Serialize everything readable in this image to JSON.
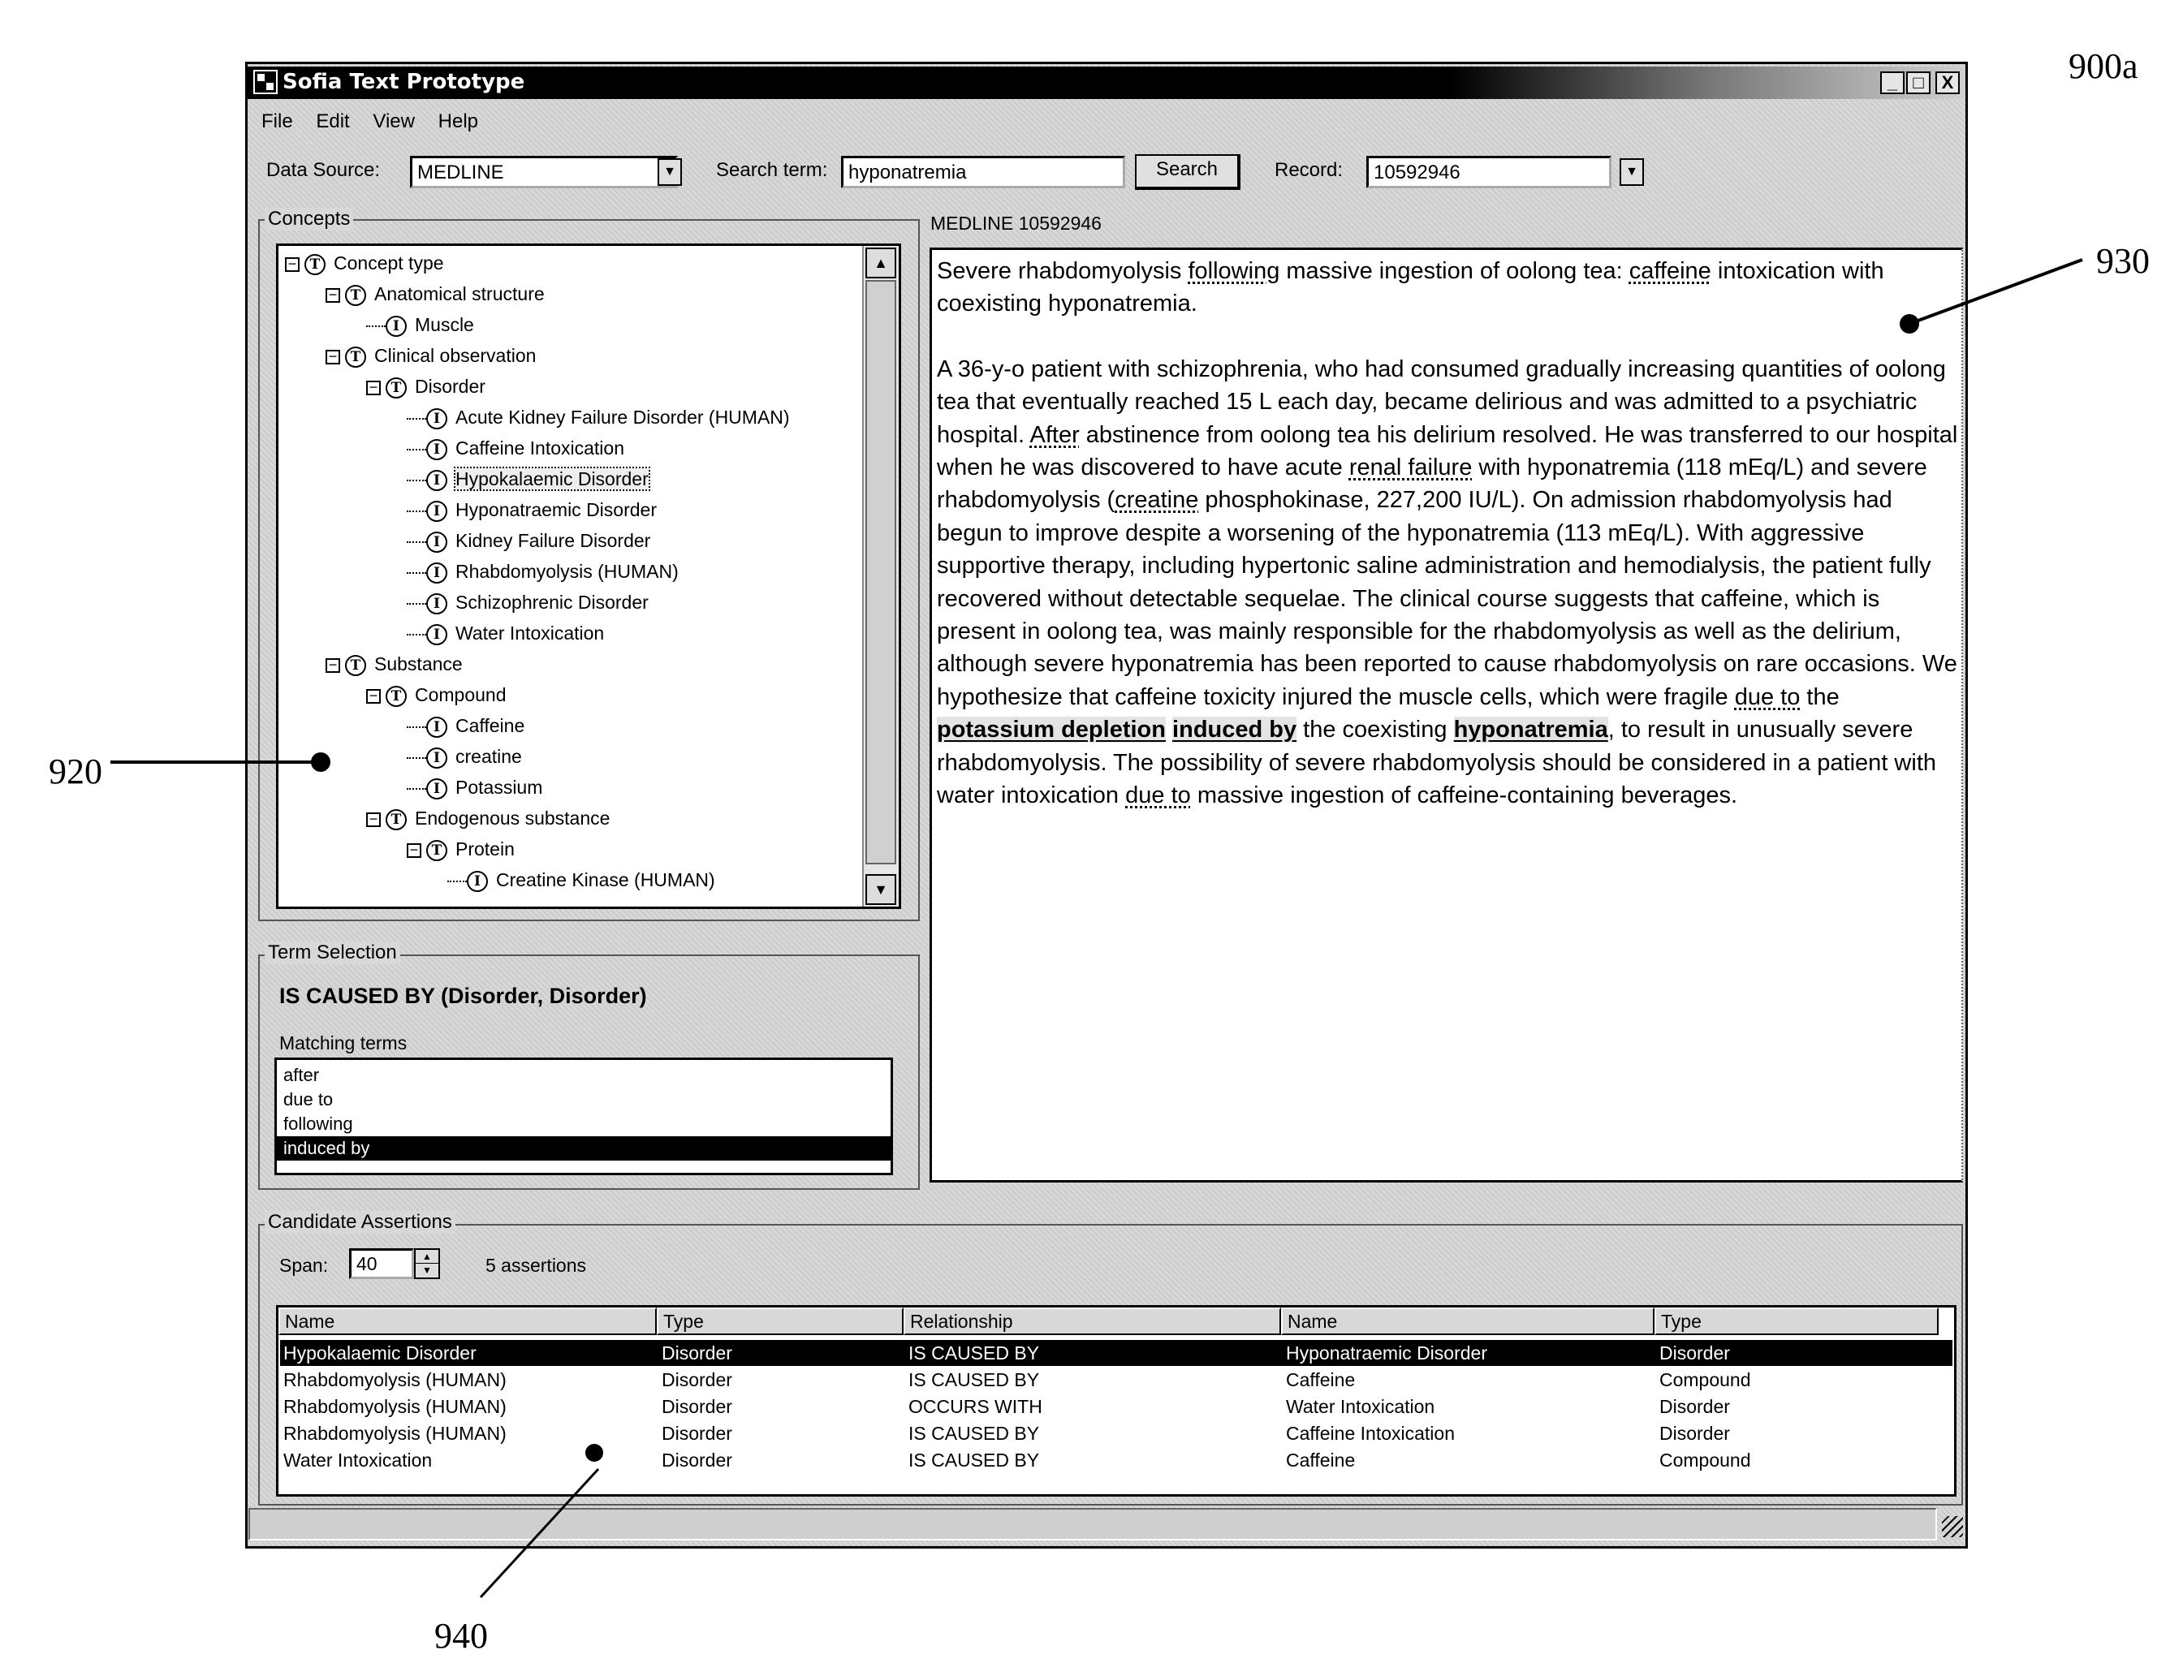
{
  "window": {
    "title": "Sofia Text Prototype",
    "controls": {
      "minimize": "_",
      "maximize": "□",
      "close": "X"
    }
  },
  "menu": [
    "File",
    "Edit",
    "View",
    "Help"
  ],
  "toolbar": {
    "data_source_label": "Data Source:",
    "data_source_value": "MEDLINE",
    "search_term_label": "Search term:",
    "search_term_value": "hyponatremia",
    "search_button": "Search",
    "record_label": "Record:",
    "record_value": "10592946"
  },
  "concepts": {
    "title": "Concepts",
    "tree": [
      {
        "label": "Concept type",
        "kind": "T",
        "depth": 0,
        "expanded": true
      },
      {
        "label": "Anatomical structure",
        "kind": "T",
        "depth": 1,
        "expanded": true
      },
      {
        "label": "Muscle",
        "kind": "I",
        "depth": 2
      },
      {
        "label": "Clinical observation",
        "kind": "T",
        "depth": 1,
        "expanded": true
      },
      {
        "label": "Disorder",
        "kind": "T",
        "depth": 2,
        "expanded": true
      },
      {
        "label": "Acute Kidney Failure Disorder (HUMAN)",
        "kind": "I",
        "depth": 3
      },
      {
        "label": "Caffeine Intoxication",
        "kind": "I",
        "depth": 3
      },
      {
        "label": "Hypokalaemic Disorder",
        "kind": "I",
        "depth": 3,
        "selected": true
      },
      {
        "label": "Hyponatraemic Disorder",
        "kind": "I",
        "depth": 3
      },
      {
        "label": "Kidney Failure Disorder",
        "kind": "I",
        "depth": 3
      },
      {
        "label": "Rhabdomyolysis (HUMAN)",
        "kind": "I",
        "depth": 3
      },
      {
        "label": "Schizophrenic Disorder",
        "kind": "I",
        "depth": 3
      },
      {
        "label": "Water Intoxication",
        "kind": "I",
        "depth": 3
      },
      {
        "label": "Substance",
        "kind": "T",
        "depth": 1,
        "expanded": true
      },
      {
        "label": "Compound",
        "kind": "T",
        "depth": 2,
        "expanded": true
      },
      {
        "label": "Caffeine",
        "kind": "I",
        "depth": 3
      },
      {
        "label": "creatine",
        "kind": "I",
        "depth": 3
      },
      {
        "label": "Potassium",
        "kind": "I",
        "depth": 3
      },
      {
        "label": "Endogenous substance",
        "kind": "T",
        "depth": 2,
        "expanded": true
      },
      {
        "label": "Protein",
        "kind": "T",
        "depth": 3,
        "expanded": true
      },
      {
        "label": "Creatine Kinase (HUMAN)",
        "kind": "I",
        "depth": 4
      }
    ],
    "scroll_up": "▲",
    "scroll_down": "▼"
  },
  "term_selection": {
    "title": "Term Selection",
    "relation": "IS CAUSED BY (Disorder, Disorder)",
    "matching_label": "Matching terms",
    "terms": [
      {
        "label": "after",
        "selected": false
      },
      {
        "label": "due to",
        "selected": false
      },
      {
        "label": "following",
        "selected": false
      },
      {
        "label": "induced by",
        "selected": true
      }
    ]
  },
  "document": {
    "header": "MEDLINE 10592946",
    "title_segments": [
      {
        "t": "Severe rhabdomyolysis "
      },
      {
        "t": "following",
        "style": "hl"
      },
      {
        "t": " massive ingestion of oolong tea: "
      },
      {
        "t": "caffeine",
        "style": "hl"
      },
      {
        "t": " intoxication with coexisting hyponatremia."
      }
    ],
    "body_segments": [
      {
        "t": "A 36-y-o patient with schizophrenia, who had consumed gradually increasing quantities of oolong tea that eventually reached 15 L each day, became delirious and was admitted to a psychiatric hospital. "
      },
      {
        "t": "After",
        "style": "hl"
      },
      {
        "t": " abstinence from oolong tea his delirium resolved. He was transferred to our hospital when he was discovered to have acute "
      },
      {
        "t": "renal failure",
        "style": "hl"
      },
      {
        "t": " with hyponatremia (118 mEq/L) and severe rhabdomyolysis ("
      },
      {
        "t": "creatine",
        "style": "hl"
      },
      {
        "t": " phosphokinase, 227,200 IU/L). On admission rhabdomyolysis had begun to improve despite a worsening of the hyponatremia (113 mEq/L). With aggressive supportive therapy, including hypertonic saline administration and hemodialysis, the patient fully recovered without detectable sequelae. The clinical course suggests that caffeine, which is present in oolong tea, was mainly responsible for the rhabdomyolysis as well as the delirium, although severe hyponatremia has been reported to cause rhabdomyolysis on rare occasions. We hypothesize that caffeine toxicity injured the muscle cells, which were fragile "
      },
      {
        "t": "due to",
        "style": "hl"
      },
      {
        "t": " the "
      },
      {
        "t": "potassium depletion",
        "style": "hl-strong"
      },
      {
        "t": " "
      },
      {
        "t": "induced by",
        "style": "hl-strong"
      },
      {
        "t": " the coexisting "
      },
      {
        "t": "hyponatremia",
        "style": "hl-strong"
      },
      {
        "t": ", to result in unusually severe rhabdomyolysis. The possibility of severe rhabdomyolysis should be considered in a patient with water intoxication "
      },
      {
        "t": "due to",
        "style": "hl"
      },
      {
        "t": " massive ingestion of caffeine-containing beverages."
      }
    ]
  },
  "assertions": {
    "title": "Candidate Assertions",
    "span_label": "Span:",
    "span_value": "40",
    "count_text": "5 assertions",
    "columns": [
      "Name",
      "Type",
      "Relationship",
      "Name",
      "Type"
    ],
    "rows": [
      {
        "cells": [
          "Hypokalaemic Disorder",
          "Disorder",
          "IS CAUSED BY",
          "Hyponatraemic Disorder",
          "Disorder"
        ],
        "selected": true
      },
      {
        "cells": [
          "Rhabdomyolysis (HUMAN)",
          "Disorder",
          "IS CAUSED BY",
          "Caffeine",
          "Compound"
        ],
        "selected": false
      },
      {
        "cells": [
          "Rhabdomyolysis (HUMAN)",
          "Disorder",
          "OCCURS WITH",
          "Water Intoxication",
          "Disorder"
        ],
        "selected": false
      },
      {
        "cells": [
          "Rhabdomyolysis (HUMAN)",
          "Disorder",
          "IS CAUSED BY",
          "Caffeine Intoxication",
          "Disorder"
        ],
        "selected": false
      },
      {
        "cells": [
          "Water Intoxication",
          "Disorder",
          "IS CAUSED BY",
          "Caffeine",
          "Compound"
        ],
        "selected": false
      }
    ]
  },
  "reference_labels": {
    "figure": "900a",
    "concepts_panel": "920",
    "text_panel": "930",
    "assertions_panel": "940"
  }
}
